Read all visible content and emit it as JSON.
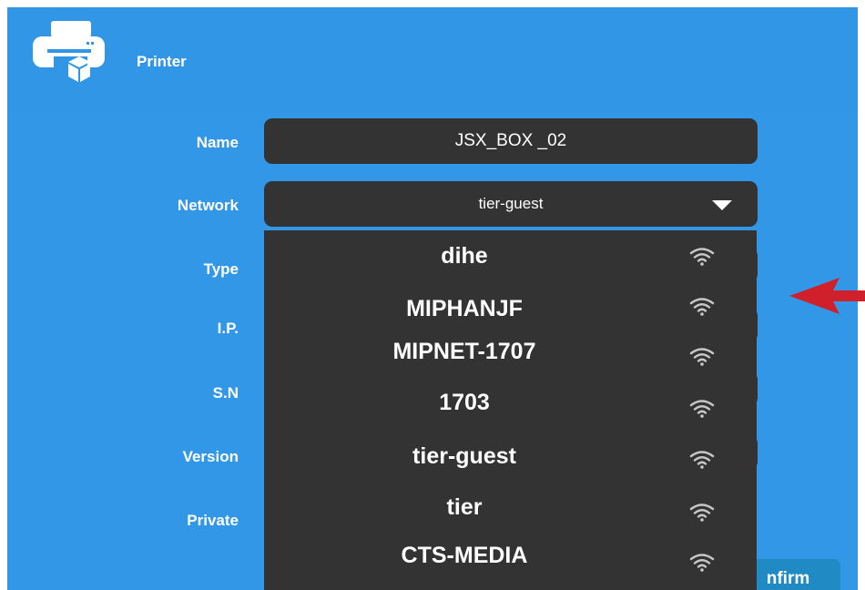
{
  "header": {
    "title": "Printer",
    "icon": "printer-icon"
  },
  "form": {
    "name_label": "Name",
    "name_value": "JSX_BOX _02",
    "network_label": "Network",
    "network_value": "tier-guest",
    "type_label": "Type",
    "ip_label": "I.P.",
    "sn_label": "S.N",
    "version_label": "Version",
    "private_label": "Private"
  },
  "dropdown": {
    "options": [
      "dihe",
      "MIPHANJF",
      "MIPNET-1707",
      "1703",
      "tier-guest",
      "tier",
      "CTS-MEDIA"
    ]
  },
  "confirm_label": "nfirm",
  "colors": {
    "panel": "#3297e6",
    "field": "#333333",
    "arrow": "#d0202b",
    "button": "#1f8ac4"
  }
}
